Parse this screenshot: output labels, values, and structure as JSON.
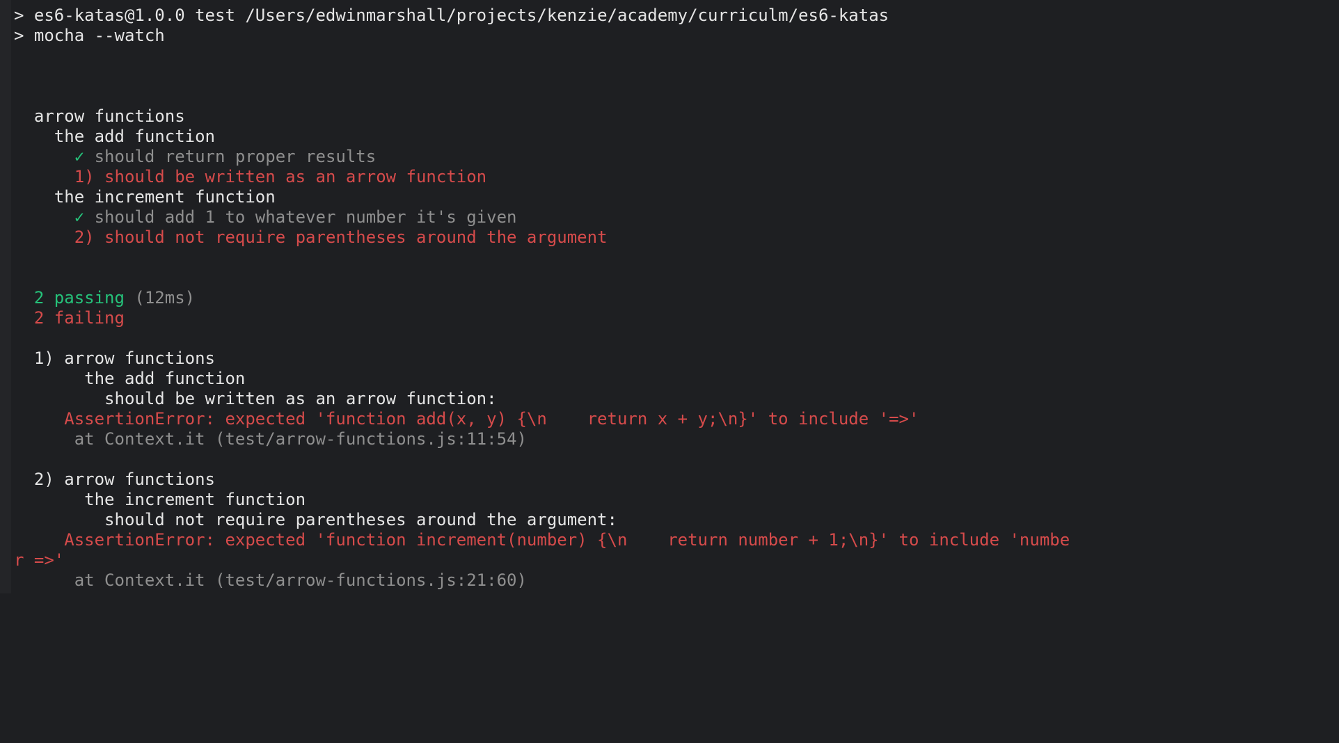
{
  "header": {
    "line1_prefix": "> ",
    "line1_text": "es6-katas@1.0.0 test /Users/edwinmarshall/projects/kenzie/academy/curriculm/es6-katas",
    "line2_prefix": "> ",
    "line2_text": "mocha --watch"
  },
  "tests": {
    "suite_root": "arrow functions",
    "suite1": {
      "title": "the add function",
      "pass_check": "✓",
      "pass_text": " should return proper results",
      "fail_num": "1)",
      "fail_text": " should be written as an arrow function"
    },
    "suite2": {
      "title": "the increment function",
      "pass_check": "✓",
      "pass_text": " should add 1 to whatever number it's given",
      "fail_num": "2)",
      "fail_text": " should not require parentheses around the argument"
    }
  },
  "summary": {
    "pass_count": "2",
    "pass_word": " passing",
    "pass_duration": " (12ms)",
    "fail_count": "2",
    "fail_word": " failing"
  },
  "errors": {
    "e1": {
      "num": "1)",
      "path1": " arrow functions",
      "path2": "the add function",
      "path3": "should be written as an arrow function:",
      "assertion": "AssertionError: expected 'function add(x, y) {\\n    return x + y;\\n}' to include '=>'",
      "stack": "at Context.it (test/arrow-functions.js:11:54)"
    },
    "e2": {
      "num": "2)",
      "path1": " arrow functions",
      "path2": "the increment function",
      "path3": "should not require parentheses around the argument:",
      "assertion_line1": "AssertionError: expected 'function increment(number) {\\n    return number + 1;\\n}' to include 'numbe",
      "assertion_line2": "r =>'",
      "stack": "at Context.it (test/arrow-functions.js:21:60)"
    }
  }
}
